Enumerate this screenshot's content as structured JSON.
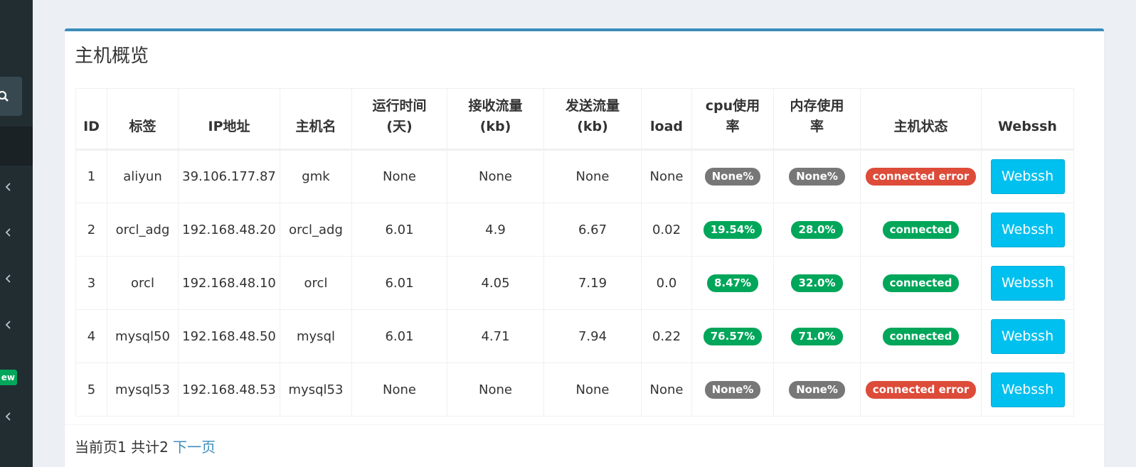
{
  "panel": {
    "title": "主机概览"
  },
  "table": {
    "headers": {
      "id": "ID",
      "tag": "标签",
      "ip": "IP地址",
      "hostname": "主机名",
      "uptime_1": "运行时间",
      "uptime_2": "(天)",
      "recv_1": "接收流量",
      "recv_2": "(kb)",
      "send_1": "发送流量",
      "send_2": "(kb)",
      "load": "load",
      "cpu_1": "cpu使用",
      "cpu_2": "率",
      "mem_1": "内存使用",
      "mem_2": "率",
      "status": "主机状态",
      "webssh": "Webssh"
    },
    "rows": [
      {
        "id": "1",
        "tag": "aliyun",
        "ip": "39.106.177.87",
        "hostname": "gmk",
        "uptime": "None",
        "recv": "None",
        "send": "None",
        "load": "None",
        "cpu": "None%",
        "mem": "None%",
        "status": "connected error",
        "webssh": "Webssh"
      },
      {
        "id": "2",
        "tag": "orcl_adg",
        "ip": "192.168.48.20",
        "hostname": "orcl_adg",
        "uptime": "6.01",
        "recv": "4.9",
        "send": "6.67",
        "load": "0.02",
        "cpu": "19.54%",
        "mem": "28.0%",
        "status": "connected",
        "webssh": "Webssh"
      },
      {
        "id": "3",
        "tag": "orcl",
        "ip": "192.168.48.10",
        "hostname": "orcl",
        "uptime": "6.01",
        "recv": "4.05",
        "send": "7.19",
        "load": "0.0",
        "cpu": "8.47%",
        "mem": "32.0%",
        "status": "connected",
        "webssh": "Webssh"
      },
      {
        "id": "4",
        "tag": "mysql50",
        "ip": "192.168.48.50",
        "hostname": "mysql",
        "uptime": "6.01",
        "recv": "4.71",
        "send": "7.94",
        "load": "0.22",
        "cpu": "76.57%",
        "mem": "71.0%",
        "status": "connected",
        "webssh": "Webssh"
      },
      {
        "id": "5",
        "tag": "mysql53",
        "ip": "192.168.48.53",
        "hostname": "mysql53",
        "uptime": "None",
        "recv": "None",
        "send": "None",
        "load": "None",
        "cpu": "None%",
        "mem": "None%",
        "status": "connected error",
        "webssh": "Webssh"
      }
    ]
  },
  "pager": {
    "info": "当前页1 共计2",
    "next": "下一页"
  },
  "sidebar": {
    "new_badge": "ew"
  },
  "colors": {
    "accent": "#3c8dbc",
    "success": "#00a65a",
    "danger": "#dd4b39",
    "neutral": "#777777",
    "info": "#00c0ef"
  }
}
